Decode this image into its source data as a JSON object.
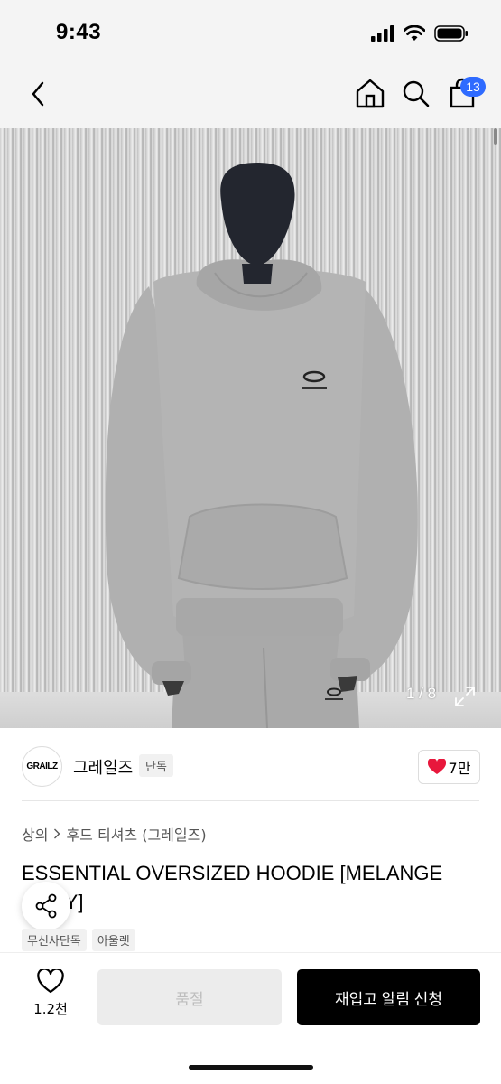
{
  "status_bar": {
    "time": "9:43"
  },
  "nav": {
    "cart_count": "13"
  },
  "hero": {
    "counter": "1 / 8",
    "garment_logo": "GRAILZ"
  },
  "brand": {
    "logo_text": "GRAILZ",
    "name": "그레일즈",
    "exclusive_tag": "단독",
    "likes": "7만"
  },
  "breadcrumb": {
    "category": "상의",
    "subcategory": "후드 티셔츠 (그레일즈)"
  },
  "product": {
    "title": "ESSENTIAL OVERSIZED HOODIE [MELANGE GREY]",
    "tags": [
      "무신사단독",
      "아울렛"
    ]
  },
  "bottom": {
    "wish_count": "1.2천",
    "soldout_label": "품절",
    "restock_label": "재입고 알림 신청"
  },
  "colors": {
    "accent_badge": "#2f6bff",
    "heart": "#e8173c",
    "primary_button": "#000000"
  },
  "icons": [
    "back-chevron-icon",
    "home-icon",
    "search-icon",
    "shopping-bag-icon",
    "expand-icon",
    "share-icon",
    "heart-icon",
    "heart-outline-icon",
    "signal-icon",
    "wifi-icon",
    "battery-icon"
  ]
}
